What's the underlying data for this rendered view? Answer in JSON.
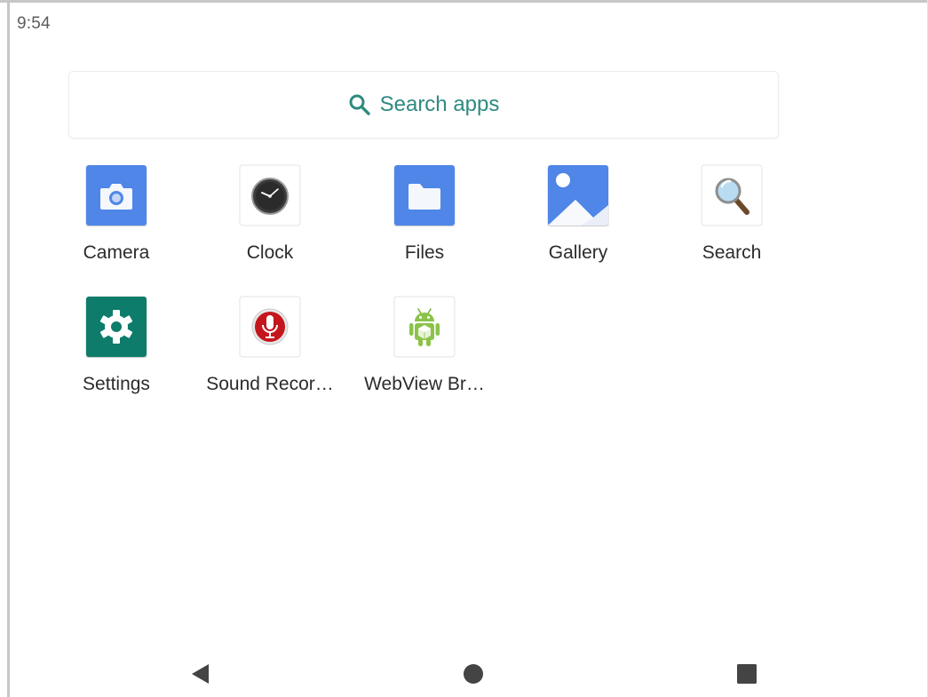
{
  "status_bar": {
    "time": "9:54"
  },
  "search": {
    "label": "Search apps",
    "icon": "search-icon"
  },
  "apps": [
    {
      "label": "Camera",
      "icon": "camera-icon"
    },
    {
      "label": "Clock",
      "icon": "clock-icon"
    },
    {
      "label": "Files",
      "icon": "folder-icon"
    },
    {
      "label": "Gallery",
      "icon": "gallery-icon"
    },
    {
      "label": "Search",
      "icon": "magnifier-icon"
    },
    {
      "label": "Settings",
      "icon": "gear-icon"
    },
    {
      "label": "Sound Recor…",
      "icon": "microphone-icon"
    },
    {
      "label": "WebView Br…",
      "icon": "android-robot-icon"
    }
  ],
  "colors": {
    "accent": "#2f8a80",
    "camera_blue": "#4f86e8",
    "settings_teal": "#0c7c6b"
  },
  "nav": {
    "back": "back-icon",
    "home": "home-icon",
    "recents": "recents-icon"
  }
}
